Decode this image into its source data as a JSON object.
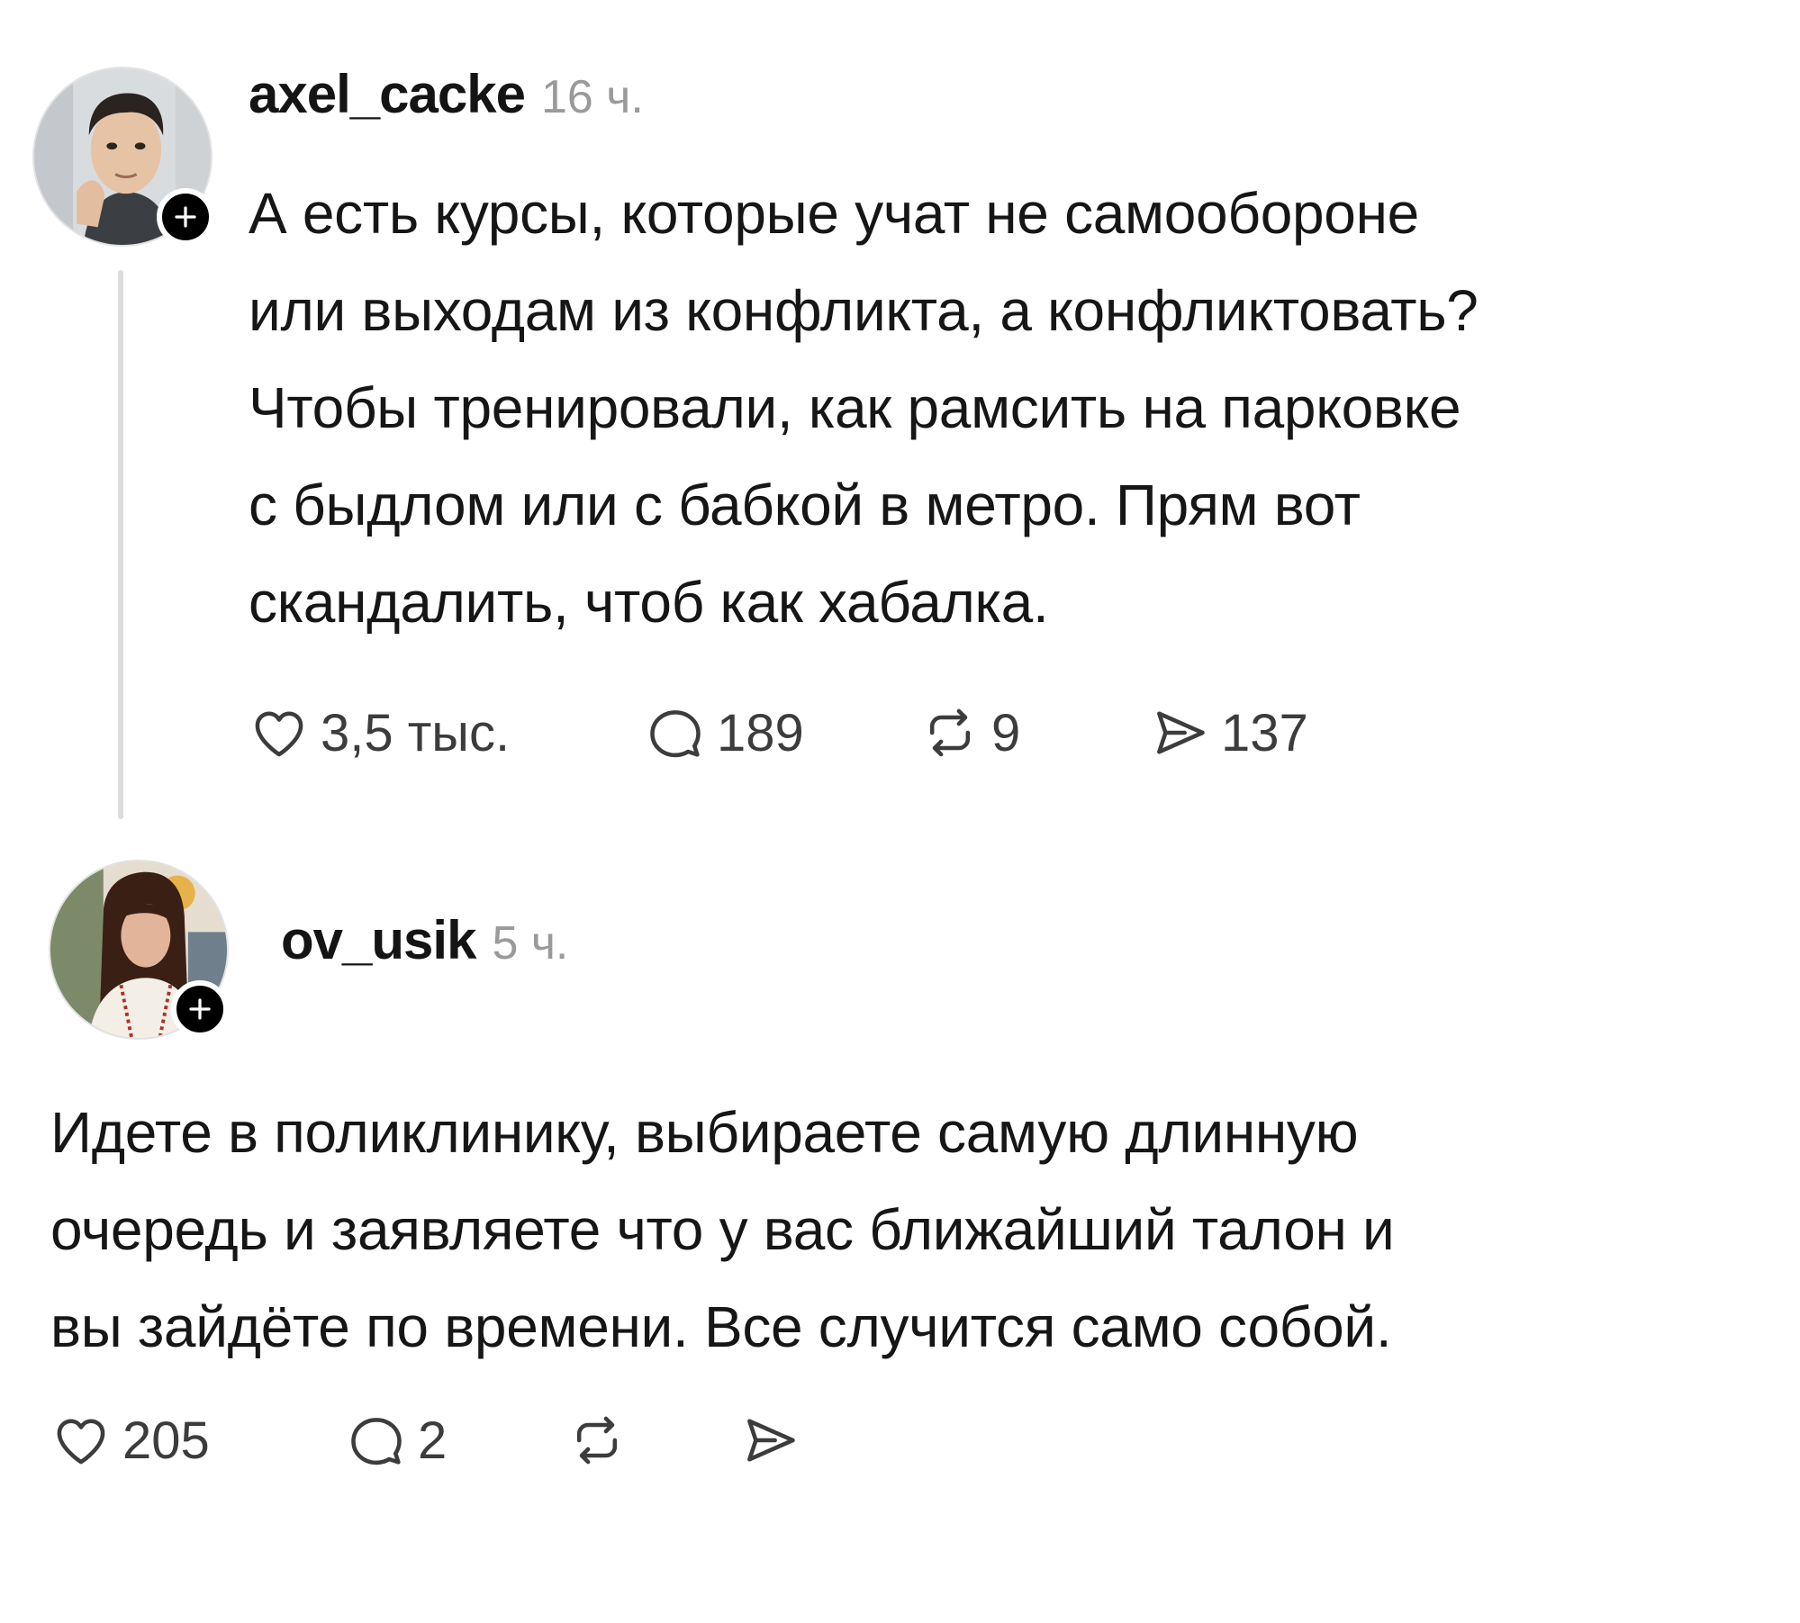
{
  "posts": [
    {
      "username": "axel_cacke",
      "time": "16 ч.",
      "text": "А есть курсы, которые учат не самообороне\nили выходам из конфликта, а конфликтовать?\nЧтобы тренировали, как рамсить на парковке\nс быдлом или с бабкой в метро. Прям вот\nскандалить, чтоб как хабалка.",
      "actions": {
        "likes": "3,5 тыс.",
        "replies": "189",
        "reposts": "9",
        "shares": "137"
      },
      "icons": [
        "heart-icon",
        "comment-icon",
        "repost-icon",
        "send-icon",
        "plus-icon"
      ]
    },
    {
      "username": "ov_usik",
      "time": "5 ч.",
      "text": "Идете в поликлинику, выбираете самую длинную\nочередь и заявляете что у вас ближайший талон и\nвы зайдёте по времени. Все случится само собой.",
      "actions": {
        "likes": "205",
        "replies": "2",
        "reposts": "",
        "shares": ""
      },
      "icons": [
        "heart-icon",
        "comment-icon",
        "repost-icon",
        "send-icon",
        "plus-icon"
      ]
    }
  ],
  "colors": {
    "text": "#161616",
    "muted": "#9a9a9a",
    "counts": "#3c3c3c",
    "thread_line": "#dcdcdc",
    "badge": "#000000",
    "background": "#ffffff"
  }
}
